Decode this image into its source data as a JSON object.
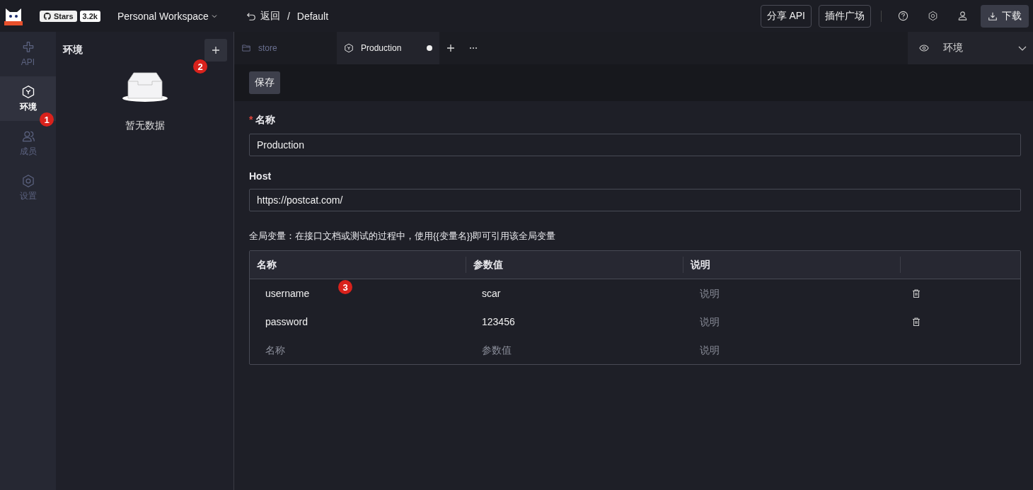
{
  "header": {
    "stars_label": "Stars",
    "stars_count": "3.2k",
    "workspace": "Personal Workspace",
    "back": "返回",
    "separator": "/",
    "project": "Default",
    "buttons": [
      "分享 API",
      "插件广场"
    ],
    "download": "下载"
  },
  "nav": [
    {
      "label": "API",
      "kind": "api",
      "selected": false
    },
    {
      "label": "环境",
      "kind": "env",
      "selected": true
    },
    {
      "label": "成员",
      "kind": "members",
      "selected": false
    },
    {
      "label": "设置",
      "kind": "settings",
      "selected": false
    }
  ],
  "panel": {
    "title": "环境",
    "empty_text": "暂无数据"
  },
  "tabs": [
    {
      "label": "store",
      "kind": "folder",
      "selected": false,
      "modified": false
    },
    {
      "label": "Production",
      "kind": "env",
      "selected": true,
      "modified": true
    }
  ],
  "env_selector": {
    "label": "环境"
  },
  "toolbar": {
    "save": "保存"
  },
  "form": {
    "name_label": "名称",
    "required_mark": "*",
    "name_value": "Production",
    "host_label": "Host",
    "host_value": "https://postcat.com/",
    "vars_hint": "全局变量：在接口文档或测试的过程中，使用{{变量名}}即可引用该全局变量"
  },
  "table": {
    "columns": [
      "名称",
      "参数值",
      "说明"
    ],
    "rows": [
      {
        "cells": [
          {
            "value": "username"
          },
          {
            "value": "scar"
          },
          {
            "placeholder": "说明"
          }
        ],
        "deletable": true
      },
      {
        "cells": [
          {
            "value": "password"
          },
          {
            "value": "123456"
          },
          {
            "placeholder": "说明"
          }
        ],
        "deletable": true
      },
      {
        "cells": [
          {
            "placeholder": "名称"
          },
          {
            "placeholder": "参数值"
          },
          {
            "placeholder": "说明"
          }
        ],
        "deletable": false
      }
    ]
  },
  "annotations": [
    {
      "text": "1"
    },
    {
      "text": "2"
    },
    {
      "text": "3"
    }
  ]
}
